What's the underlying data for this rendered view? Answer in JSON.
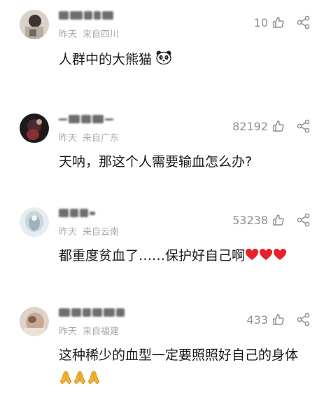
{
  "comments": [
    {
      "username_hidden": true,
      "time": "昨天",
      "location": "来自四川",
      "likes": "10",
      "text": "人群中的大熊猫",
      "emoji": "panda-face"
    },
    {
      "username_hidden": true,
      "time": "昨天",
      "location": "来自广东",
      "likes": "82192",
      "text": "天呐，那这个人需要输血怎么办?",
      "emoji": ""
    },
    {
      "username_hidden": true,
      "time": "昨天",
      "location": "来自云南",
      "likes": "53238",
      "text": "都重度贫血了……保护好自己啊",
      "emoji": "red-heart x3"
    },
    {
      "username_hidden": true,
      "time": "昨天",
      "location": "来自福建",
      "likes": "433",
      "text": "这种稀少的血型一定要照照好自己的身体",
      "emoji": "folded-hands x3"
    }
  ],
  "colors": {
    "meta": "#a8a8a8",
    "likes": "#8f8f8f",
    "text": "#1a1a1a",
    "heart": "#e8202a"
  }
}
